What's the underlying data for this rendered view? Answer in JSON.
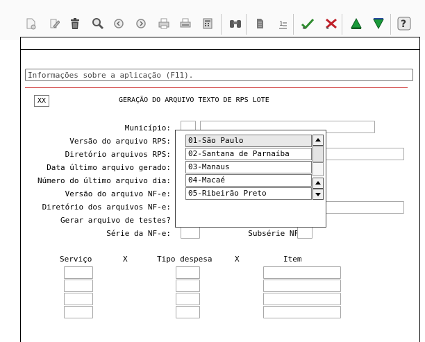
{
  "toolbar": {
    "icons": [
      "new-document-icon",
      "edit-icon",
      "delete-trash-icon",
      "search-magnifier-icon",
      "previous-record-icon",
      "next-record-icon",
      "print-icon",
      "print-setup-icon",
      "calculator-icon",
      "binoculars-icon",
      "document-icon",
      "list-numbered-icon",
      "confirm-check-icon",
      "cancel-icon",
      "navigate-up-icon",
      "navigate-down-icon",
      "help-icon"
    ],
    "colors": {
      "check": "#2e8b2e",
      "cancel": "#c0202a",
      "up": "#1a9a3a",
      "down": "#1a9a3a"
    }
  },
  "info_bar": {
    "text": "Informações sobre a aplicação (F11)."
  },
  "form": {
    "checkbox_value": "XX",
    "title": "GERAÇÃO DO ARQUIVO TEXTO DE RPS LOTE",
    "labels": {
      "municipio": "Município:",
      "versao_rps": "Versão do arquivo RPS:",
      "diretorio_rps": "Diretório arquivos RPS:",
      "data_ultimo": "Data último arquivo gerado:",
      "numero_ultimo": "Número do último arquivo dia:",
      "versao_nfe": "Versão do arquivo NF-e:",
      "diretorio_nfe": "Diretório dos arquivos NF-e:",
      "gerar_testes": "Gerar arquivo de testes?",
      "serie_nfe": "Série da NF-e:",
      "subserie_nfe": "Subsérie NF-e:"
    }
  },
  "dropdown": {
    "options": [
      "01-São Paulo",
      "02-Santana de Parnaíba",
      "03-Manaus",
      "04-Macaé",
      "05-Ribeirão Preto"
    ]
  },
  "table": {
    "headers": {
      "servico": "Serviço",
      "x1": "X",
      "tipo_despesa": "Tipo despesa",
      "x2": "X",
      "item": "Item"
    }
  }
}
